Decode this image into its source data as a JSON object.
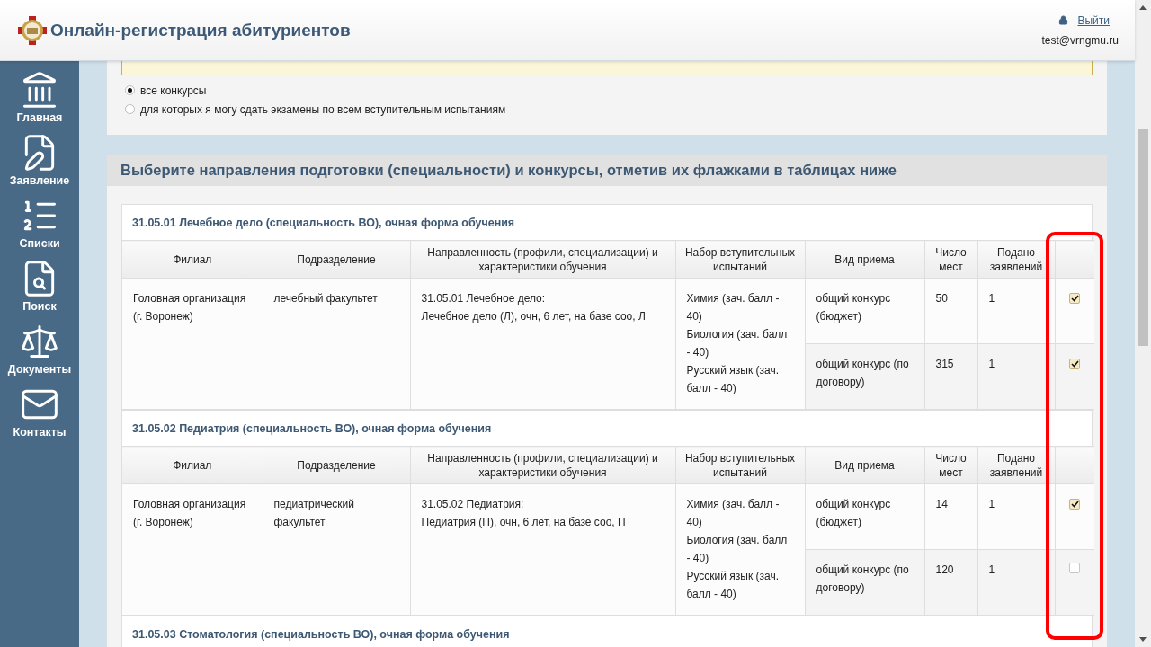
{
  "header": {
    "title": "Онлайн-регистрация абитуриентов",
    "logout_link": "Выйти",
    "user_email": "test@vrngmu.ru"
  },
  "sidebar": {
    "items": [
      {
        "label": "Главная"
      },
      {
        "label": "Заявление"
      },
      {
        "label": "Списки"
      },
      {
        "label": "Поиск"
      },
      {
        "label": "Документы"
      },
      {
        "label": "Контакты"
      }
    ]
  },
  "filter": {
    "options": [
      {
        "label": "все конкурсы",
        "selected": true
      },
      {
        "label": "для которых я могу сдать экзамены по всем вступительным испытаниям",
        "selected": false
      }
    ]
  },
  "section": {
    "title": "Выберите направления подготовки (специальности) и конкурсы, отметив их флажками в таблицах ниже"
  },
  "programs": [
    {
      "title": "31.05.01 Лечебное дело (специальность ВО), очная форма обучения",
      "columns": [
        "Филиал",
        "Подразделение",
        "Направленность (профили, специализации) и характеристики обучения",
        "Набор вступительных испытаний",
        "Вид приема",
        "Число мест",
        "Подано заявлений"
      ],
      "branch": "Головная организация (г. Воронеж)",
      "department": "лечебный факультет",
      "profile": [
        "31.05.01 Лечебное дело:",
        "Лечебное дело (Л), очн, 6 лет, на базе соо, Л"
      ],
      "exams": [
        "Химия (зач. балл - 40)",
        "Биология (зач. балл - 40)",
        "Русский язык (зач. балл - 40)"
      ],
      "admissions": [
        {
          "type": "общий конкурс (бюджет)",
          "seats": "50",
          "applied": "1",
          "checked": true
        },
        {
          "type": "общий конкурс (по договору)",
          "seats": "315",
          "applied": "1",
          "checked": true
        }
      ]
    },
    {
      "title": "31.05.02 Педиатрия (специальность ВО), очная форма обучения",
      "columns": [
        "Филиал",
        "Подразделение",
        "Направленность (профили, специализации) и характеристики обучения",
        "Набор вступительных испытаний",
        "Вид приема",
        "Число мест",
        "Подано заявлений"
      ],
      "branch": "Головная организация (г. Воронеж)",
      "department": "педиатрический факультет",
      "profile": [
        "31.05.02 Педиатрия:",
        "Педиатрия (П), очн, 6 лет, на базе соо, П"
      ],
      "exams": [
        "Химия (зач. балл - 40)",
        "Биология (зач. балл - 40)",
        "Русский язык (зач. балл - 40)"
      ],
      "admissions": [
        {
          "type": "общий конкурс (бюджет)",
          "seats": "14",
          "applied": "1",
          "checked": true
        },
        {
          "type": "общий конкурс (по договору)",
          "seats": "120",
          "applied": "1",
          "checked": false
        }
      ]
    },
    {
      "title": "31.05.03 Стоматология (специальность ВО), очная форма обучения"
    }
  ]
}
